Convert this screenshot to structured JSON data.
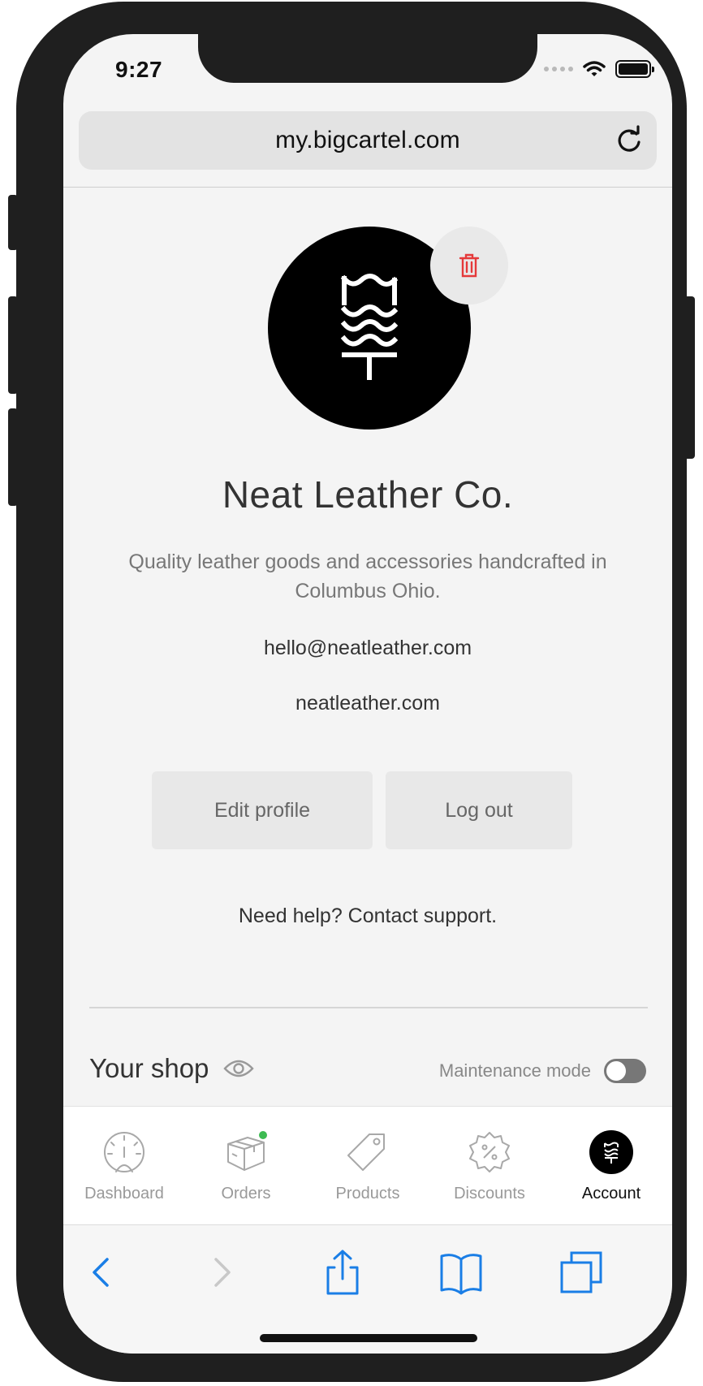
{
  "status": {
    "time": "9:27"
  },
  "browser": {
    "url": "my.bigcartel.com"
  },
  "profile": {
    "name": "Neat Leather Co.",
    "description": "Quality leather goods and accessories handcrafted in Columbus Ohio.",
    "email": "hello@neatleather.com",
    "website": "neatleather.com",
    "edit_label": "Edit profile",
    "logout_label": "Log out",
    "help_text": "Need help? Contact support."
  },
  "shop": {
    "title": "Your shop",
    "maintenance_label": "Maintenance mode",
    "maintenance_on": false
  },
  "tabs": [
    {
      "label": "Dashboard",
      "icon": "dashboard-icon",
      "active": false
    },
    {
      "label": "Orders",
      "icon": "box-icon",
      "active": false,
      "has_notification": true
    },
    {
      "label": "Products",
      "icon": "tag-icon",
      "active": false
    },
    {
      "label": "Discounts",
      "icon": "discount-badge-icon",
      "active": false
    },
    {
      "label": "Account",
      "icon": "account-logo-icon",
      "active": true
    }
  ],
  "colors": {
    "accent_blue": "#1a7ee6",
    "delete_red": "#e5393a",
    "notify_green": "#3dbb52"
  }
}
